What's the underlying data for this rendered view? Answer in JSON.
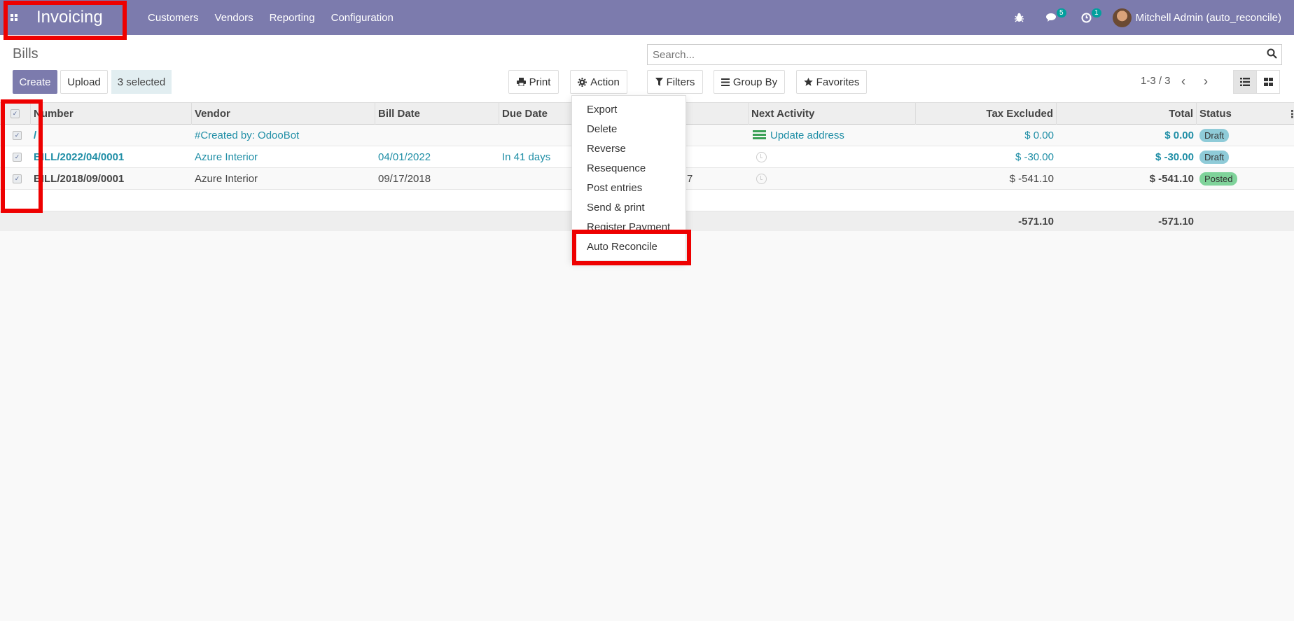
{
  "navbar": {
    "app_title": "Invoicing",
    "menu": [
      "Customers",
      "Vendors",
      "Reporting",
      "Configuration"
    ],
    "messages_count": "5",
    "activities_count": "1",
    "user_name": "Mitchell Admin (auto_reconcile)"
  },
  "control_panel": {
    "breadcrumb": "Bills",
    "create_label": "Create",
    "upload_label": "Upload",
    "selected_label": "3 selected",
    "print_label": "Print",
    "action_label": "Action",
    "filters_label": "Filters",
    "groupby_label": "Group By",
    "favorites_label": "Favorites",
    "search_placeholder": "Search...",
    "pager": "1-3 / 3"
  },
  "table": {
    "headers": {
      "number": "Number",
      "vendor": "Vendor",
      "bill_date": "Bill Date",
      "due_date": "Due Date",
      "next_activity": "Next Activity",
      "tax_excluded": "Tax Excluded",
      "total": "Total",
      "status": "Status"
    },
    "rows": [
      {
        "number": "/",
        "vendor": "#Created by: OdooBot",
        "bill_date": "",
        "due_date": "",
        "hidden_col": "",
        "activity": "Update address",
        "tax_excluded": "$ 0.00",
        "total": "$ 0.00",
        "status": "Draft"
      },
      {
        "number": "BILL/2022/04/0001",
        "vendor": "Azure Interior",
        "bill_date": "04/01/2022",
        "due_date": "In 41 days",
        "hidden_col": "",
        "activity": "",
        "tax_excluded": "$ -30.00",
        "total": "$ -30.00",
        "status": "Draft"
      },
      {
        "number": "BILL/2018/09/0001",
        "vendor": "Azure Interior",
        "bill_date": "09/17/2018",
        "due_date": "",
        "hidden_col": "7",
        "activity": "",
        "tax_excluded": "$ -541.10",
        "total": "$ -541.10",
        "status": "Posted"
      }
    ],
    "footer": {
      "tax_excluded": "-571.10",
      "total": "-571.10"
    }
  },
  "action_menu": {
    "items": [
      "Export",
      "Delete",
      "Reverse",
      "Resequence",
      "Post entries",
      "Send & print",
      "Register Payment",
      "Auto Reconcile"
    ]
  },
  "colors": {
    "brand": "#7c7bad",
    "link": "#1f8ea6",
    "highlight": "#ee0000"
  }
}
